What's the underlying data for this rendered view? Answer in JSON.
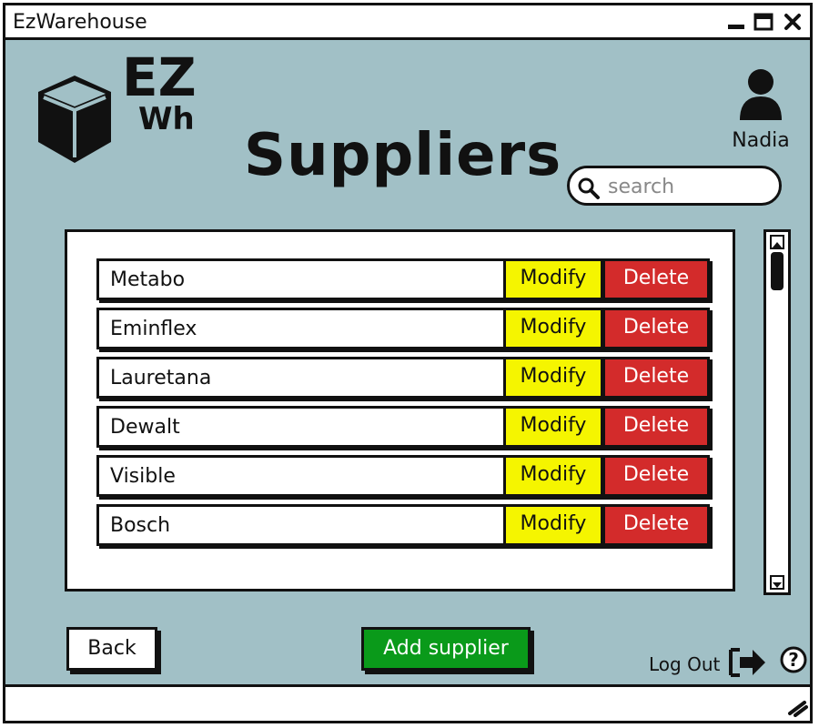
{
  "window": {
    "title": "EzWarehouse"
  },
  "logo": {
    "line1": "EZ",
    "line2": "Wh"
  },
  "page": {
    "title": "Suppliers"
  },
  "user": {
    "name": "Nadia"
  },
  "search": {
    "placeholder": "search"
  },
  "suppliers": [
    {
      "name": "Metabo",
      "modify_label": "Modify",
      "delete_label": "Delete"
    },
    {
      "name": "Eminflex",
      "modify_label": "Modify",
      "delete_label": "Delete"
    },
    {
      "name": "Lauretana",
      "modify_label": "Modify",
      "delete_label": "Delete"
    },
    {
      "name": "Dewalt",
      "modify_label": "Modify",
      "delete_label": "Delete"
    },
    {
      "name": "Visible",
      "modify_label": "Modify",
      "delete_label": "Delete"
    },
    {
      "name": "Bosch",
      "modify_label": "Modify",
      "delete_label": "Delete"
    }
  ],
  "footer": {
    "back_label": "Back",
    "add_label": "Add supplier",
    "logout_label": "Log Out"
  },
  "colors": {
    "background": "#a1c0c6",
    "modify": "#f5f500",
    "delete": "#d32b2b",
    "add": "#0a9a1a"
  },
  "icons": {
    "minimize": "minimize-icon",
    "maximize": "maximize-icon",
    "close": "close-icon",
    "user": "user-icon",
    "search": "search-icon",
    "logout": "logout-icon",
    "help": "help-icon",
    "resize": "resize-grip-icon",
    "logo": "cube-icon"
  }
}
